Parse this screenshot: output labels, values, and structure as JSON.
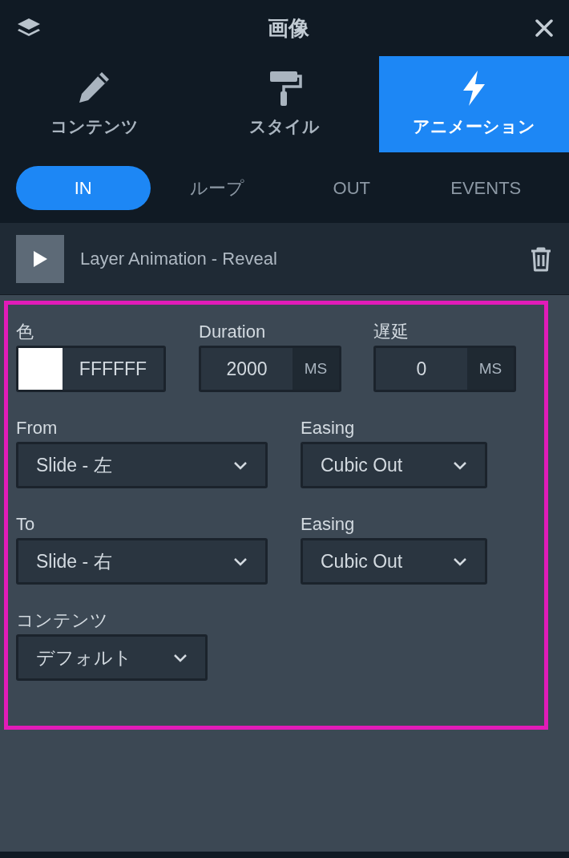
{
  "header": {
    "title": "画像"
  },
  "tabs": [
    {
      "label": "コンテンツ",
      "selected": false
    },
    {
      "label": "スタイル",
      "selected": false
    },
    {
      "label": "アニメーション",
      "selected": true
    }
  ],
  "subtabs": [
    {
      "label": "IN",
      "selected": true
    },
    {
      "label": "ループ",
      "selected": false
    },
    {
      "label": "OUT",
      "selected": false
    },
    {
      "label": "EVENTS",
      "selected": false
    }
  ],
  "layer": {
    "title": "Layer Animation - Reveal"
  },
  "color_field": {
    "label": "色",
    "value": "FFFFFF"
  },
  "number_fields": [
    {
      "label": "Duration",
      "value": "2000",
      "unit": "MS"
    },
    {
      "label": "遅延",
      "value": "0",
      "unit": "MS"
    }
  ],
  "select_rows": [
    [
      {
        "label": "From",
        "value": "Slide - 左"
      },
      {
        "label": "Easing",
        "value": "Cubic Out"
      }
    ],
    [
      {
        "label": "To",
        "value": "Slide - 右"
      },
      {
        "label": "Easing",
        "value": "Cubic Out"
      }
    ],
    [
      {
        "label": "コンテンツ",
        "value": "デフォルト"
      }
    ]
  ]
}
